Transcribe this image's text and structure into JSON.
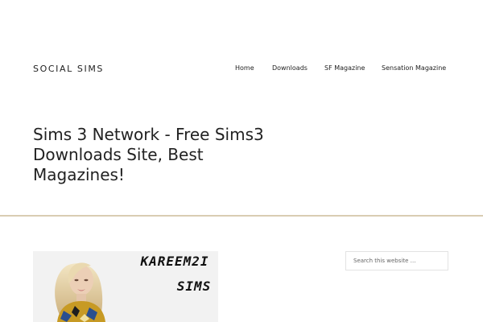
{
  "header": {
    "site_title": "SOCIAL SIMS"
  },
  "nav": {
    "items": [
      {
        "label": "Home"
      },
      {
        "label": "Downloads"
      },
      {
        "label": "SF Magazine"
      },
      {
        "label": "Sensation Magazine"
      }
    ]
  },
  "main": {
    "page_title": "Sims 3 Network - Free Sims3 Downloads Site, Best Magazines!",
    "featured_image": {
      "line1": "KAREEM2I",
      "line2": "SIMS"
    }
  },
  "sidebar": {
    "search_placeholder": "Search this website …"
  },
  "colors": {
    "divider": "#d9cdb2",
    "text": "#222222"
  }
}
